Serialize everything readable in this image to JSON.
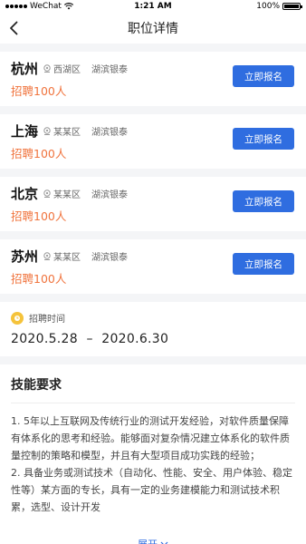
{
  "status_bar": {
    "carrier": "WeChat",
    "time": "1:21 AM",
    "battery": "100%"
  },
  "nav": {
    "title": "职位详情"
  },
  "locations": [
    {
      "city": "杭州",
      "district": "西湖区",
      "building": "湖滨银泰",
      "recruit": "招聘100人",
      "button": "立即报名"
    },
    {
      "city": "上海",
      "district": "某某区",
      "building": "湖滨银泰",
      "recruit": "招聘100人",
      "button": "立即报名"
    },
    {
      "city": "北京",
      "district": "某某区",
      "building": "湖滨银泰",
      "recruit": "招聘100人",
      "button": "立即报名"
    },
    {
      "city": "苏州",
      "district": "某某区",
      "building": "湖滨银泰",
      "recruit": "招聘100人",
      "button": "立即报名"
    }
  ],
  "recruit_time": {
    "label": "招聘时间",
    "range": "2020.5.28  –  2020.6.30"
  },
  "skills": {
    "title": "技能要求",
    "lines": [
      "1. 5年以上互联网及传统行业的测试开发经验，对软件质量保障有体系化的思考和经验。能够面对复杂情况建立体系化的软件质量控制的策略和模型，并且有大型项目成功实践的经验；",
      "2. 具备业务或测试技术（自动化、性能、安全、用户体验、稳定性等）某方面的专长，具有一定的业务建模能力和测试技术积累，选型、设计开发"
    ],
    "expand_label": "展开"
  },
  "colors": {
    "accent": "#2f6de0",
    "recruit": "#f0743e",
    "clock": "#f5c33b"
  }
}
